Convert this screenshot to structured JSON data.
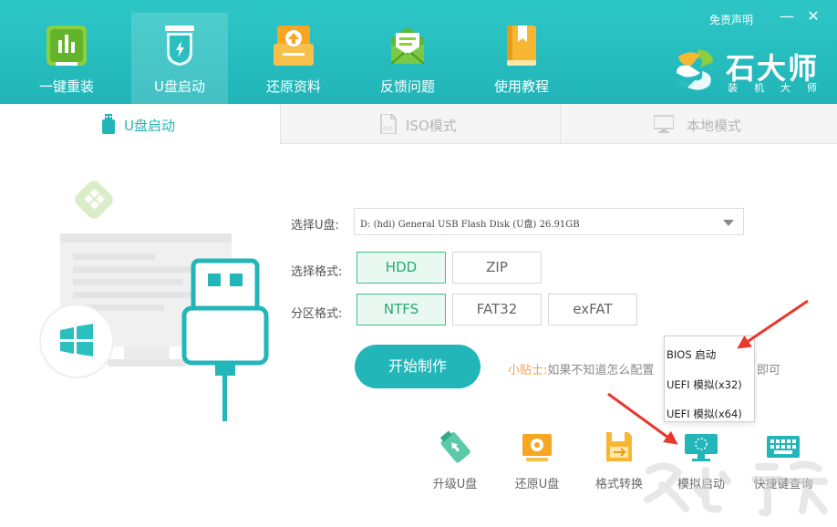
{
  "header": {
    "nav": [
      {
        "label": "一键重装",
        "icon": "bar-chart-icon"
      },
      {
        "label": "U盘启动",
        "icon": "usb-drive-icon"
      },
      {
        "label": "还原资料",
        "icon": "restore-upload-icon"
      },
      {
        "label": "反馈问题",
        "icon": "mail-envelope-icon"
      },
      {
        "label": "使用教程",
        "icon": "book-icon"
      }
    ],
    "active_nav": "U盘启动",
    "disclaimer": "免责声明",
    "minimize": "—",
    "close": "✕",
    "brand": {
      "name": "石大师",
      "sub": "装机大师"
    }
  },
  "tabs": [
    {
      "label": "U盘启动",
      "icon": "usb-stick-icon",
      "active": true
    },
    {
      "label": "ISO模式",
      "icon": "iso-file-icon",
      "active": false
    },
    {
      "label": "本地模式",
      "icon": "monitor-icon",
      "active": false
    }
  ],
  "form": {
    "select_usb_label": "选择U盘:",
    "select_usb_value": "D: (hdi) General USB Flash Disk  (U盘) 26.91GB",
    "format_label": "选择格式:",
    "format_options": [
      "HDD",
      "ZIP"
    ],
    "format_selected": "HDD",
    "partition_label": "分区格式:",
    "partition_options": [
      "NTFS",
      "FAT32",
      "exFAT"
    ],
    "partition_selected": "NTFS",
    "start_button": "开始制作",
    "tip_title": "小贴士:",
    "tip_text": "如果不知道怎么配置",
    "tip_tail": "即可"
  },
  "menu": {
    "items": [
      "BIOS 启动",
      "UEFI 模拟(x32)",
      "UEFI 模拟(x64)"
    ]
  },
  "tools": [
    {
      "label": "升级U盘",
      "icon": "usb-upgrade-icon"
    },
    {
      "label": "还原U盘",
      "icon": "usb-restore-icon"
    },
    {
      "label": "格式转换",
      "icon": "format-convert-icon"
    },
    {
      "label": "模拟启动",
      "icon": "simulate-boot-icon"
    },
    {
      "label": "快捷键查询",
      "icon": "keyboard-icon"
    }
  ],
  "colors": {
    "header_teal": "#22b6b8",
    "selected_green": "#3cc08a",
    "tip_orange": "#f0a24a",
    "arrow_red": "#e8372d"
  }
}
